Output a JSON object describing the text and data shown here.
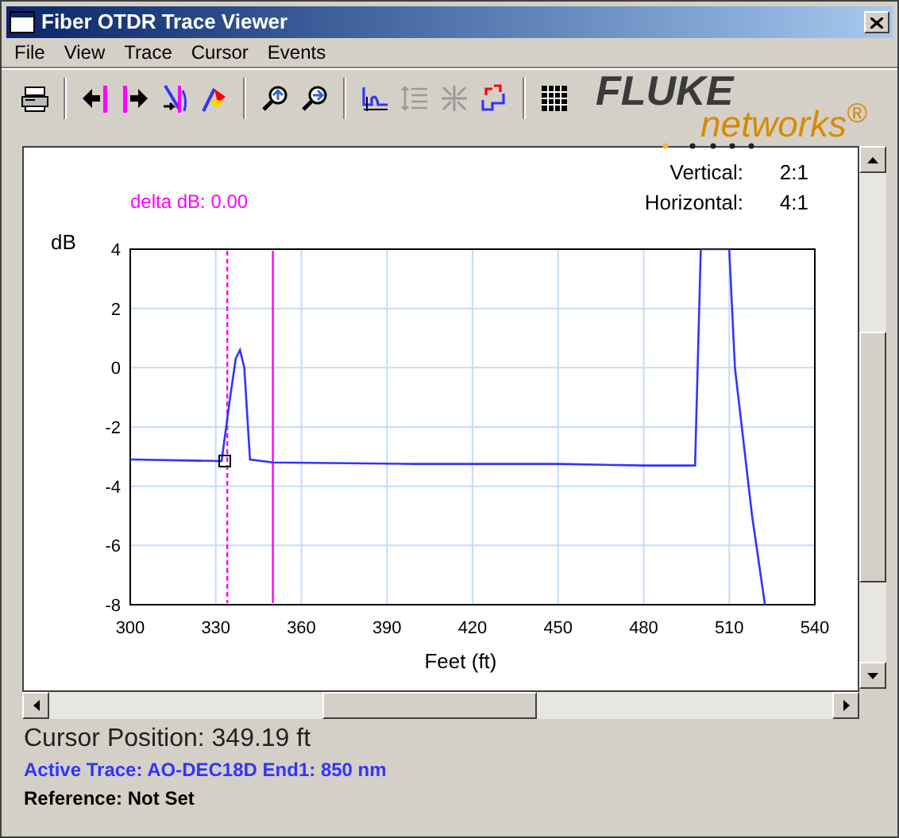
{
  "window": {
    "title": "Fiber OTDR Trace Viewer"
  },
  "menu": [
    "File",
    "View",
    "Trace",
    "Cursor",
    "Events"
  ],
  "toolbar": [
    [
      {
        "kind": "print",
        "disabled": false
      }
    ],
    [
      {
        "kind": "cursor-left",
        "disabled": false
      },
      {
        "kind": "cursor-right",
        "disabled": false
      },
      {
        "kind": "cursor-both",
        "disabled": false
      },
      {
        "kind": "flag",
        "disabled": false
      }
    ],
    [
      {
        "kind": "zoom-in",
        "disabled": false
      },
      {
        "kind": "zoom-out",
        "disabled": false
      }
    ],
    [
      {
        "kind": "trace",
        "disabled": false
      },
      {
        "kind": "lines",
        "disabled": true
      },
      {
        "kind": "compress",
        "disabled": true
      },
      {
        "kind": "swap",
        "disabled": false
      }
    ],
    [
      {
        "kind": "table",
        "disabled": false
      }
    ]
  ],
  "logo": {
    "brand": "FLUKE",
    "sub": "networks$^{®}$"
  },
  "chart": {
    "scale": [
      {
        "label": "Vertical:",
        "value": "2:1"
      },
      {
        "label": "Horizontal:",
        "value": "4:1"
      }
    ],
    "delta": "delta dB: 0.00",
    "chart_data": {
      "type": "line",
      "xlabel": "Feet (ft)",
      "ylabel": "dB",
      "xlim": [
        300,
        540
      ],
      "ylim": [
        -8,
        4
      ],
      "xticks": [
        300,
        330,
        360,
        390,
        420,
        450,
        480,
        510,
        540
      ],
      "yticks": [
        -8,
        -6,
        -4,
        -2,
        0,
        2,
        4
      ],
      "grid": true,
      "ref_lines": [
        {
          "axis": "x",
          "value": 334,
          "color": "#ff00ff"
        },
        {
          "axis": "x",
          "value": 350,
          "color": "#ff00ff"
        }
      ],
      "x": [
        300,
        332,
        335,
        337,
        338.5,
        340,
        342,
        350,
        400,
        450,
        480,
        498,
        500,
        510,
        512,
        518,
        522.5
      ],
      "series": [
        {
          "color": "#3333ff",
          "values": [
            -3.1,
            -3.15,
            -1,
            0.3,
            0.6,
            0,
            -3.1,
            -3.2,
            -3.25,
            -3.25,
            -3.3,
            -3.3,
            4,
            4,
            0,
            -5,
            -8
          ]
        }
      ]
    }
  },
  "status": {
    "cursor": "Cursor Position: 349.19 ft",
    "active": "Active Trace: AO-DEC18D End1: 850 nm",
    "reference": "Reference: Not Set"
  }
}
